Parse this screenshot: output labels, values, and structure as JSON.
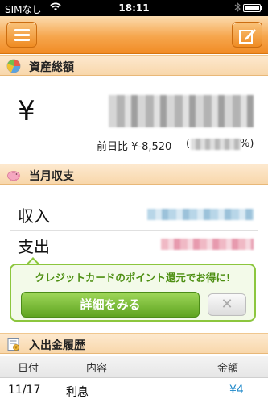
{
  "status_bar": {
    "carrier": "SIMなし",
    "time": "18:11"
  },
  "sections": {
    "assets": {
      "title": "資産総額"
    },
    "monthly": {
      "title": "当月収支"
    },
    "history": {
      "title": "入出金履歴"
    }
  },
  "assets": {
    "currency_symbol": "¥",
    "change_label": "前日比 ¥-8,520",
    "change_open": "(",
    "change_suffix": "%)"
  },
  "monthly": {
    "income_label": "収入",
    "expense_label": "支出"
  },
  "promo": {
    "message": "クレジットカードのポイント還元でお得に!",
    "detail_button": "詳細をみる",
    "close_glyph": "✕"
  },
  "history_table": {
    "columns": [
      "日付",
      "内容",
      "金額"
    ],
    "rows": [
      {
        "date": "11/17",
        "description": "利息",
        "amount": "¥4"
      }
    ]
  },
  "colors": {
    "navbar_orange": "#f18c26",
    "promo_green": "#8cc63e",
    "amount_blue": "#1a86c8"
  }
}
